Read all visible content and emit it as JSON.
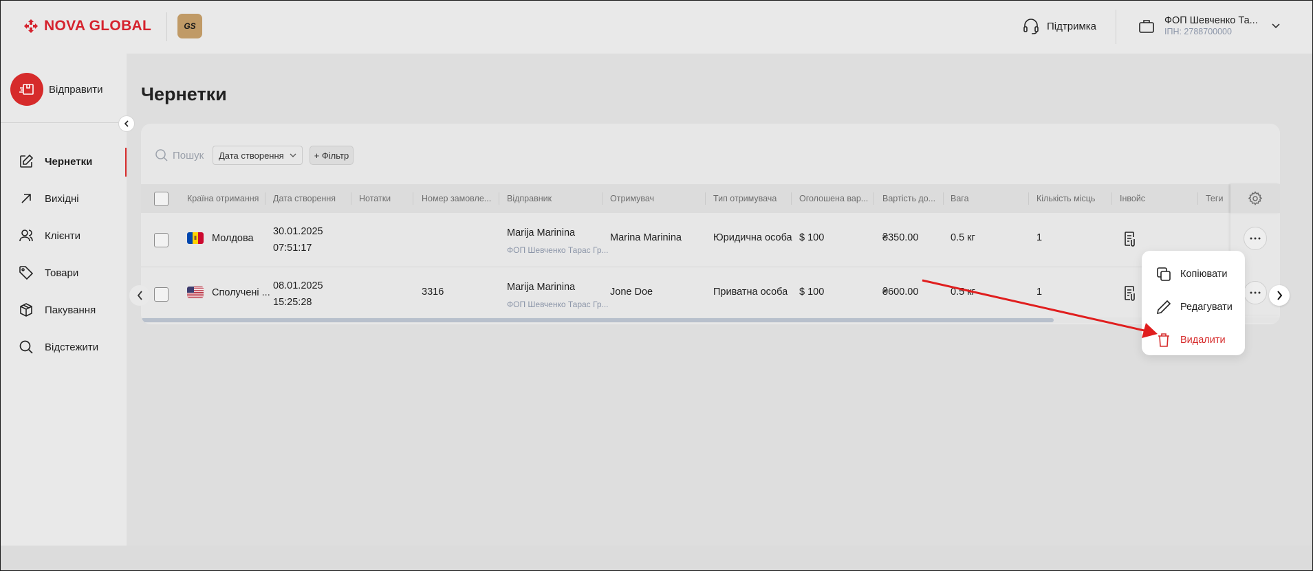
{
  "colors": {
    "brand_red": "#d62b2b",
    "sidebar_bg": "#e9e9e9",
    "main_bg": "#dedede",
    "muted_text": "#8b95a8"
  },
  "header": {
    "logo_text": "NOVA GLOBAL",
    "badge_text": "GS",
    "support_label": "Підтримка",
    "account_name": "ФОП Шевченко Та...",
    "account_ipn": "ІПН: 2788700000"
  },
  "sidebar": {
    "send_label": "Відправити",
    "items": [
      {
        "label": "Чернетки",
        "icon": "edit-icon",
        "active": true
      },
      {
        "label": "Вихідні",
        "icon": "arrow-up-right-icon"
      },
      {
        "label": "Клієнти",
        "icon": "users-icon"
      },
      {
        "label": "Товари",
        "icon": "tag-icon"
      },
      {
        "label": "Пакування",
        "icon": "box-icon"
      },
      {
        "label": "Відстежити",
        "icon": "search-icon"
      }
    ]
  },
  "page": {
    "title": "Чернетки"
  },
  "toolbar": {
    "search_placeholder": "Пошук",
    "date_select_value": "Дата створення",
    "filter_label": "+ Фільтр"
  },
  "table": {
    "columns": [
      "Країна отримання",
      "Дата створення",
      "Нотатки",
      "Номер замовле...",
      "Відправник",
      "Отримувач",
      "Тип отримувача",
      "Оголошена вар...",
      "Вартість до...",
      "Вага",
      "Кількість місць",
      "Інвойс",
      "Теги"
    ],
    "rows": [
      {
        "country": "Молдова",
        "flag": "moldova",
        "date": "30.01.2025",
        "time": "07:51:17",
        "notes": "",
        "order_number": "",
        "sender": "Marija Marinina",
        "sender_company": "ФОП Шевченко Тарас Гр...",
        "recipient": "Marina Marinina",
        "recipient_type": "Юридична особа",
        "declared_value": "$ 100",
        "delivery_cost": "₴350.00",
        "weight": "0.5 кг",
        "places": "1"
      },
      {
        "country": "Сполучені ...",
        "flag": "usa",
        "date": "08.01.2025",
        "time": "15:25:28",
        "notes": "",
        "order_number": "3316",
        "sender": "Marija Marinina",
        "sender_company": "ФОП Шевченко Тарас Гр...",
        "recipient": "Jone Doe",
        "recipient_type": "Приватна особа",
        "declared_value": "$ 100",
        "delivery_cost": "₴600.00",
        "weight": "0.5 кг",
        "places": "1"
      }
    ]
  },
  "context_menu": {
    "items": [
      {
        "label": "Копіювати",
        "icon": "copy-icon"
      },
      {
        "label": "Редагувати",
        "icon": "pencil-icon"
      },
      {
        "label": "Видалити",
        "icon": "trash-icon",
        "danger": true
      }
    ]
  }
}
